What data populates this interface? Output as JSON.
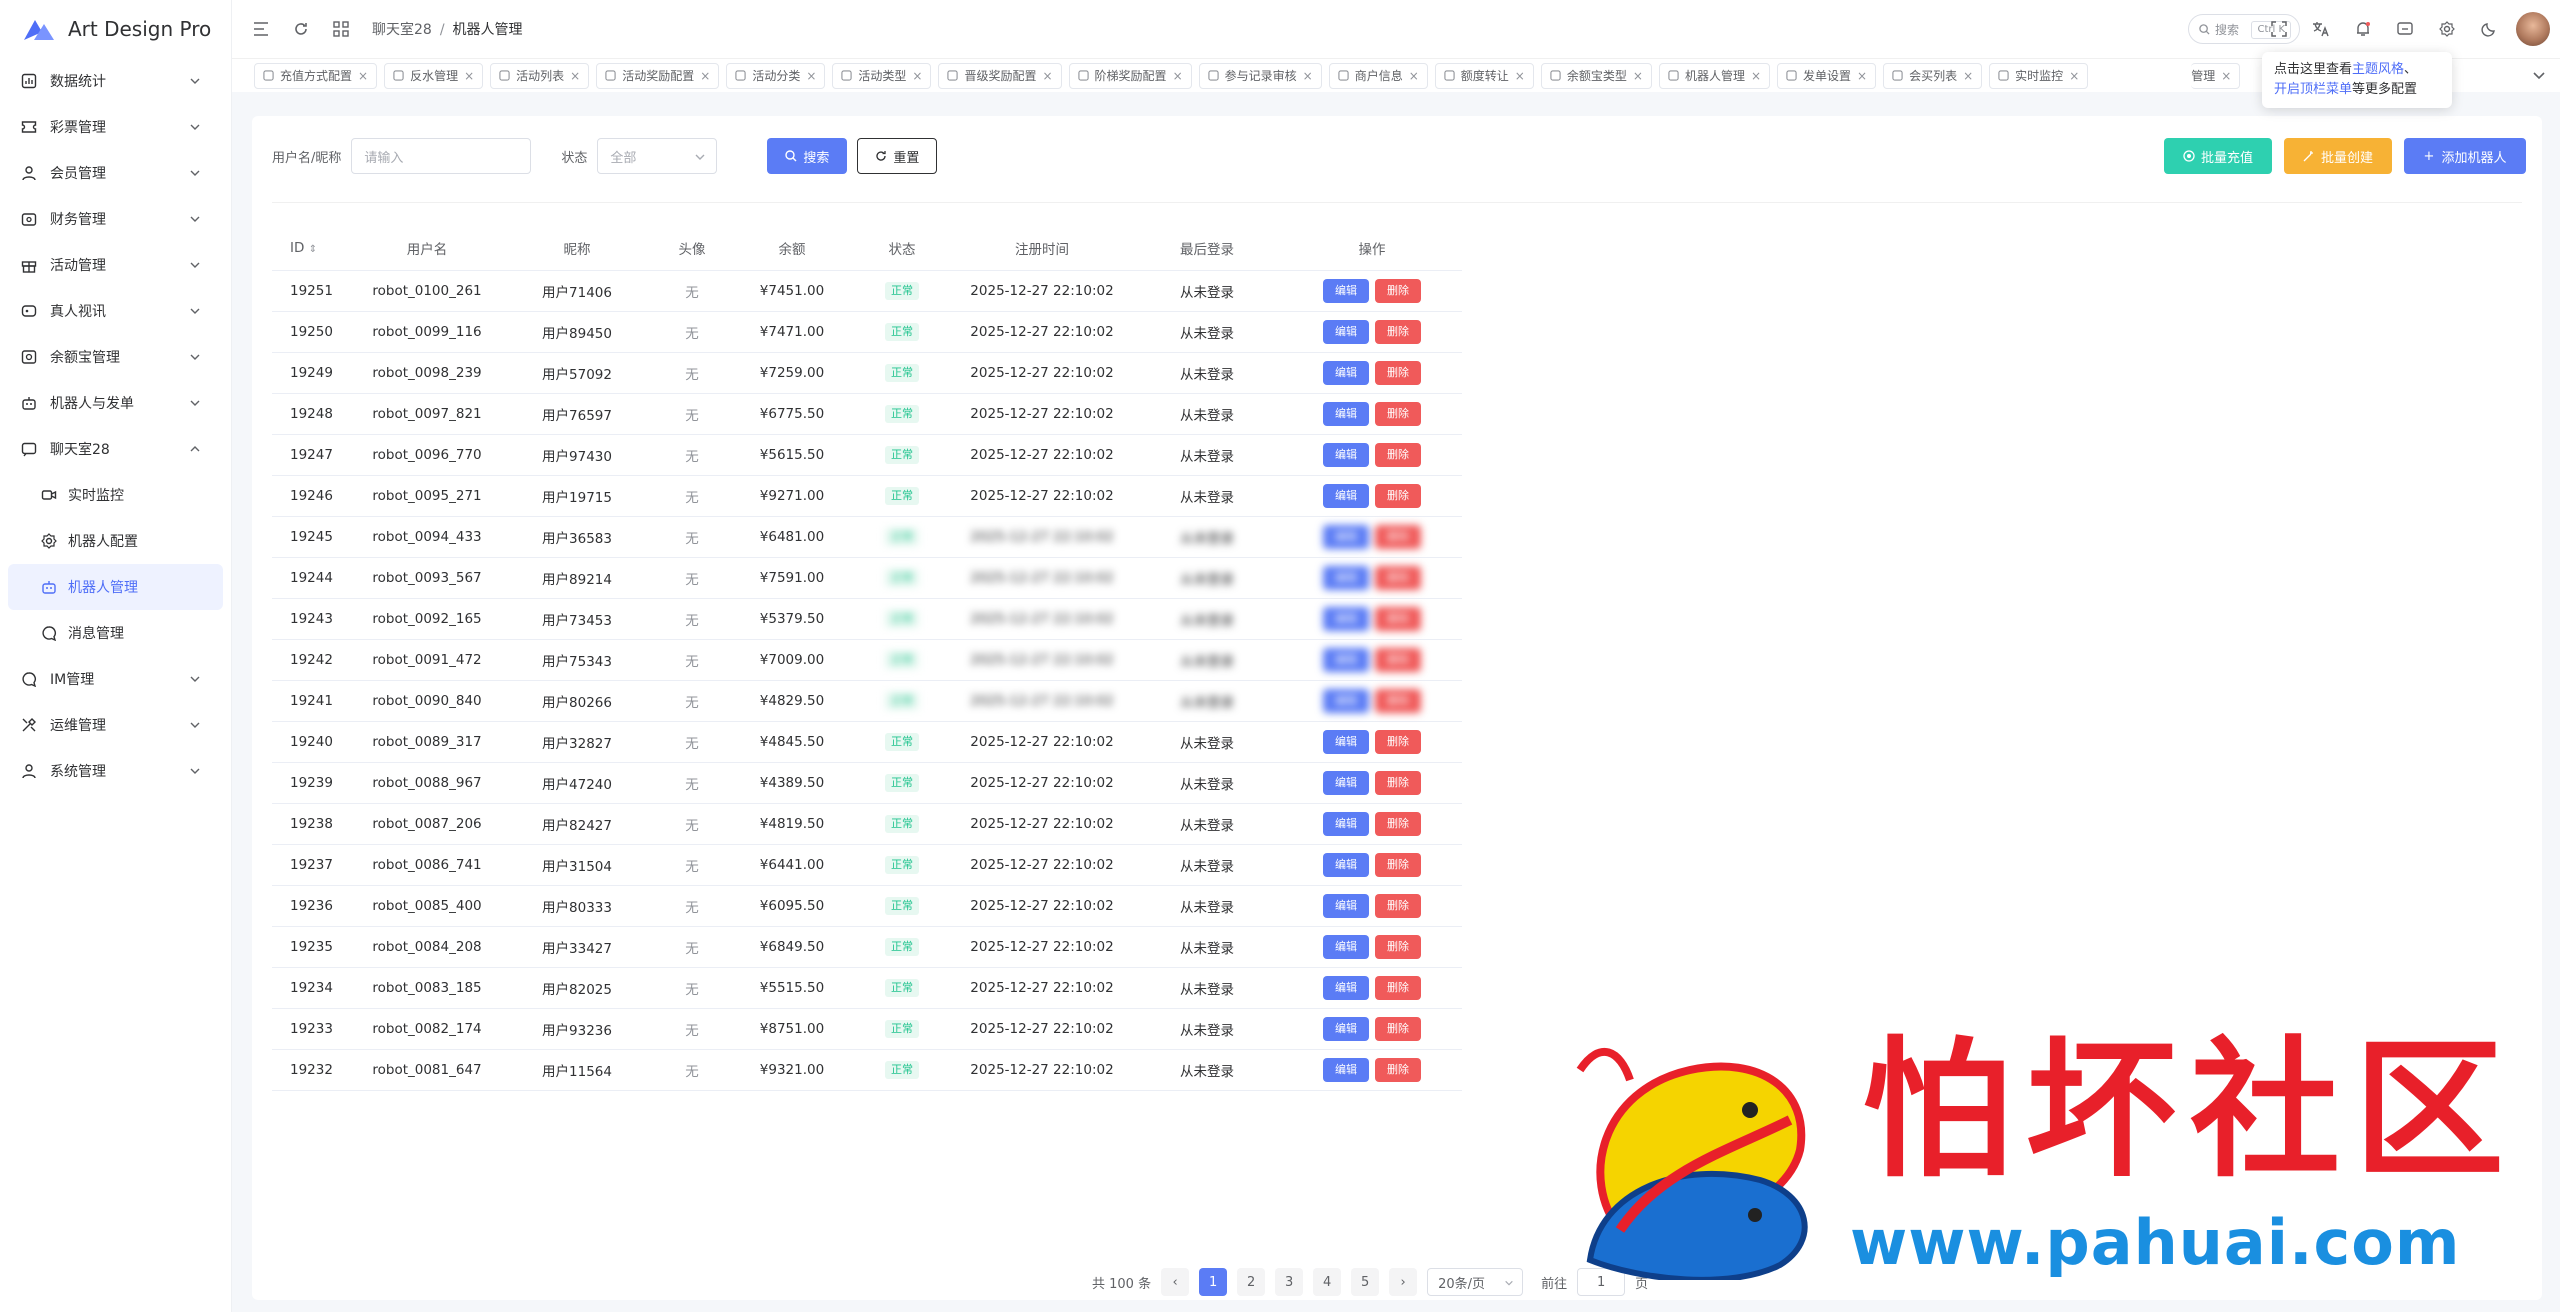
{
  "app": {
    "name": "Art Design Pro"
  },
  "sidebar": {
    "items": [
      {
        "label": "数据统计",
        "icon": "chart-icon",
        "expanded": false
      },
      {
        "label": "彩票管理",
        "icon": "ticket-icon",
        "expanded": false
      },
      {
        "label": "会员管理",
        "icon": "user-icon",
        "expanded": false
      },
      {
        "label": "财务管理",
        "icon": "wallet-icon",
        "expanded": false
      },
      {
        "label": "活动管理",
        "icon": "gift-icon",
        "expanded": false
      },
      {
        "label": "真人视讯",
        "icon": "video-icon",
        "expanded": false
      },
      {
        "label": "余额宝管理",
        "icon": "vault-icon",
        "expanded": false
      },
      {
        "label": "机器人与发单",
        "icon": "robot-icon",
        "expanded": false
      },
      {
        "label": "聊天室28",
        "icon": "chat-icon",
        "expanded": true
      }
    ],
    "subitems": [
      {
        "label": "实时监控",
        "icon": "camera-icon"
      },
      {
        "label": "机器人配置",
        "icon": "gear-icon"
      },
      {
        "label": "机器人管理",
        "icon": "robot-icon",
        "active": true
      },
      {
        "label": "消息管理",
        "icon": "message-icon"
      }
    ],
    "items2": [
      {
        "label": "IM管理",
        "icon": "message-icon"
      },
      {
        "label": "运维管理",
        "icon": "tools-icon"
      },
      {
        "label": "系统管理",
        "icon": "user-icon"
      }
    ]
  },
  "breadcrumb": {
    "parent": "聊天室28",
    "sep": "/",
    "current": "机器人管理"
  },
  "search": {
    "placeholder": "搜索",
    "shortcut": "Ctrl K"
  },
  "tabs": [
    "充值方式配置",
    "反水管理",
    "活动列表",
    "活动奖励配置",
    "活动分类",
    "活动类型",
    "晋级奖励配置",
    "阶梯奖励配置",
    "参与记录审核",
    "商户信息",
    "额度转让",
    "余额宝类型",
    "机器人管理",
    "发单设置",
    "会买列表",
    "实时监控"
  ],
  "tab_hidden_tail": "管理",
  "tooltip": {
    "line1_pre": "点击这里查看",
    "line1_link": "主题风格",
    "line1_post": "、",
    "line2_link": "开启顶栏菜单",
    "line2_post": "等更多配置"
  },
  "filter": {
    "username_label": "用户名/昵称",
    "username_placeholder": "请输入",
    "status_label": "状态",
    "status_value": "全部",
    "search_btn": "搜索",
    "reset_btn": "重置"
  },
  "actions": {
    "recharge": "批量充值",
    "batch_create": "批量创建",
    "add": "添加机器人"
  },
  "table": {
    "columns": [
      "ID",
      "用户名",
      "昵称",
      "头像",
      "余额",
      "状态",
      "注册时间",
      "最后登录",
      "操作"
    ],
    "edit_label": "编辑",
    "delete_label": "删除",
    "rows": [
      {
        "id": "19251",
        "username": "robot_0100_261",
        "nickname": "用户71406",
        "avatar": "无",
        "balance": "¥7451.00",
        "status": "正常",
        "reg": "2025-12-27 22:10:02",
        "last": "从未登录",
        "blur": false
      },
      {
        "id": "19250",
        "username": "robot_0099_116",
        "nickname": "用户89450",
        "avatar": "无",
        "balance": "¥7471.00",
        "status": "正常",
        "reg": "2025-12-27 22:10:02",
        "last": "从未登录",
        "blur": false
      },
      {
        "id": "19249",
        "username": "robot_0098_239",
        "nickname": "用户57092",
        "avatar": "无",
        "balance": "¥7259.00",
        "status": "正常",
        "reg": "2025-12-27 22:10:02",
        "last": "从未登录",
        "blur": false
      },
      {
        "id": "19248",
        "username": "robot_0097_821",
        "nickname": "用户76597",
        "avatar": "无",
        "balance": "¥6775.50",
        "status": "正常",
        "reg": "2025-12-27 22:10:02",
        "last": "从未登录",
        "blur": false
      },
      {
        "id": "19247",
        "username": "robot_0096_770",
        "nickname": "用户97430",
        "avatar": "无",
        "balance": "¥5615.50",
        "status": "正常",
        "reg": "2025-12-27 22:10:02",
        "last": "从未登录",
        "blur": false
      },
      {
        "id": "19246",
        "username": "robot_0095_271",
        "nickname": "用户19715",
        "avatar": "无",
        "balance": "¥9271.00",
        "status": "正常",
        "reg": "2025-12-27 22:10:02",
        "last": "从未登录",
        "blur": false
      },
      {
        "id": "19245",
        "username": "robot_0094_433",
        "nickname": "用户36583",
        "avatar": "无",
        "balance": "¥6481.00",
        "status": "正常",
        "reg": "2025-12-27 22:10:02",
        "last": "从未登录",
        "blur": true
      },
      {
        "id": "19244",
        "username": "robot_0093_567",
        "nickname": "用户89214",
        "avatar": "无",
        "balance": "¥7591.00",
        "status": "正常",
        "reg": "2025-12-27 22:10:02",
        "last": "从未登录",
        "blur": true
      },
      {
        "id": "19243",
        "username": "robot_0092_165",
        "nickname": "用户73453",
        "avatar": "无",
        "balance": "¥5379.50",
        "status": "正常",
        "reg": "2025-12-27 22:10:02",
        "last": "从未登录",
        "blur": true
      },
      {
        "id": "19242",
        "username": "robot_0091_472",
        "nickname": "用户75343",
        "avatar": "无",
        "balance": "¥7009.00",
        "status": "正常",
        "reg": "2025-12-27 22:10:02",
        "last": "从未登录",
        "blur": true
      },
      {
        "id": "19241",
        "username": "robot_0090_840",
        "nickname": "用户80266",
        "avatar": "无",
        "balance": "¥4829.50",
        "status": "正常",
        "reg": "2025-12-27 22:10:02",
        "last": "从未登录",
        "blur": true
      },
      {
        "id": "19240",
        "username": "robot_0089_317",
        "nickname": "用户32827",
        "avatar": "无",
        "balance": "¥4845.50",
        "status": "正常",
        "reg": "2025-12-27 22:10:02",
        "last": "从未登录",
        "blur": false
      },
      {
        "id": "19239",
        "username": "robot_0088_967",
        "nickname": "用户47240",
        "avatar": "无",
        "balance": "¥4389.50",
        "status": "正常",
        "reg": "2025-12-27 22:10:02",
        "last": "从未登录",
        "blur": false
      },
      {
        "id": "19238",
        "username": "robot_0087_206",
        "nickname": "用户82427",
        "avatar": "无",
        "balance": "¥4819.50",
        "status": "正常",
        "reg": "2025-12-27 22:10:02",
        "last": "从未登录",
        "blur": false
      },
      {
        "id": "19237",
        "username": "robot_0086_741",
        "nickname": "用户31504",
        "avatar": "无",
        "balance": "¥6441.00",
        "status": "正常",
        "reg": "2025-12-27 22:10:02",
        "last": "从未登录",
        "blur": false
      },
      {
        "id": "19236",
        "username": "robot_0085_400",
        "nickname": "用户80333",
        "avatar": "无",
        "balance": "¥6095.50",
        "status": "正常",
        "reg": "2025-12-27 22:10:02",
        "last": "从未登录",
        "blur": false
      },
      {
        "id": "19235",
        "username": "robot_0084_208",
        "nickname": "用户33427",
        "avatar": "无",
        "balance": "¥6849.50",
        "status": "正常",
        "reg": "2025-12-27 22:10:02",
        "last": "从未登录",
        "blur": false
      },
      {
        "id": "19234",
        "username": "robot_0083_185",
        "nickname": "用户82025",
        "avatar": "无",
        "balance": "¥5515.50",
        "status": "正常",
        "reg": "2025-12-27 22:10:02",
        "last": "从未登录",
        "blur": false
      },
      {
        "id": "19233",
        "username": "robot_0082_174",
        "nickname": "用户93236",
        "avatar": "无",
        "balance": "¥8751.00",
        "status": "正常",
        "reg": "2025-12-27 22:10:02",
        "last": "从未登录",
        "blur": false
      },
      {
        "id": "19232",
        "username": "robot_0081_647",
        "nickname": "用户11564",
        "avatar": "无",
        "balance": "¥9321.00",
        "status": "正常",
        "reg": "2025-12-27 22:10:02",
        "last": "从未登录",
        "blur": false
      }
    ]
  },
  "pagination": {
    "total_text": "共 100 条",
    "pages": [
      "1",
      "2",
      "3",
      "4",
      "5"
    ],
    "current": "1",
    "page_size": "20条/页",
    "goto_label": "前往",
    "goto_value": "1",
    "page_unit": "页"
  },
  "watermark": {
    "text": "怕坏社区",
    "url": "www.pahuai.com"
  },
  "colors": {
    "primary": "#5b7cf5",
    "success": "#2ed0b0",
    "warning": "#f7b235",
    "danger": "#f05a5a"
  }
}
